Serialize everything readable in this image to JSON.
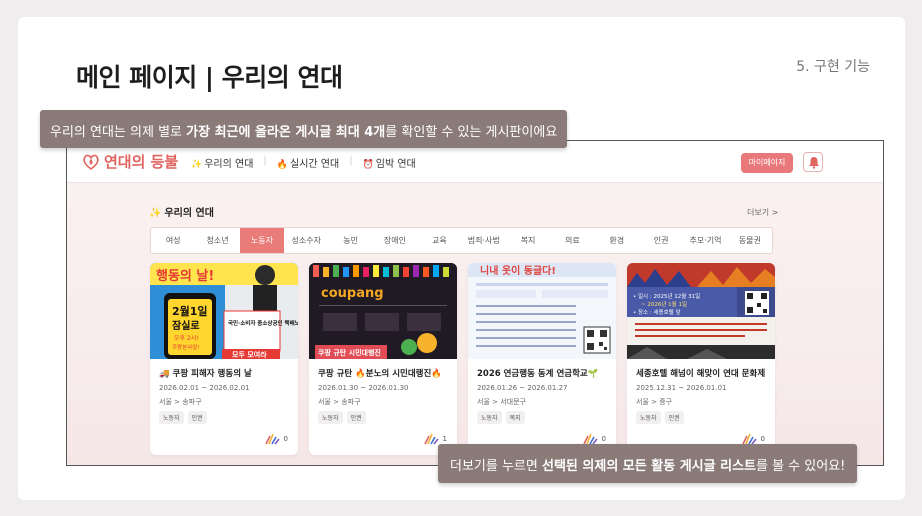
{
  "slide": {
    "title": "메인 페이지 | 우리의 연대",
    "section": "5. 구현 기능"
  },
  "callouts": {
    "top": {
      "pre": "우리의 연대는 의제 별로 ",
      "bold": "가장 최근에 올라온 게시글 최대 4개",
      "post": "를 확인할 수 있는 게시판이에요"
    },
    "bottom": {
      "pre": "더보기를 누르면 ",
      "bold": "선택된 의제의 모든 활동 게시글 리스트",
      "post": "를 볼 수 있어요!"
    }
  },
  "app": {
    "logo_text": "연대의 등불",
    "nav": [
      {
        "icon": "✨",
        "label": "우리의 연대"
      },
      {
        "icon": "🔥",
        "label": "실시간 연대"
      },
      {
        "icon": "⏰",
        "label": "임박 연대"
      }
    ],
    "mypage_label": "마이페이지",
    "board_title": "우리의 연대",
    "board_title_icon": "✨",
    "more_label": "더보기 >",
    "tabs": [
      "여성",
      "청소년",
      "노동자",
      "성소수자",
      "농민",
      "장애인",
      "교육",
      "범죄·사법",
      "복지",
      "의료",
      "환경",
      "인권",
      "추모·기억",
      "동물권"
    ],
    "active_tab": "노동자",
    "cards": [
      {
        "title": "🚚 쿠팡 피해자 행동의 날",
        "date": "2026.02.01 ~ 2026.02.01",
        "location": "서울 > 송파구",
        "tags": [
          "노동자",
          "인권"
        ],
        "count": "0",
        "thumb": {
          "headline": "행동의 날!",
          "date_big": "2월1일",
          "place": "잠실로",
          "time": "오후 2시!",
          "place2": "쿠팡본사앞!",
          "side": "국민·소비자 중소상공인 택배노동자",
          "cta": "모두 모여라"
        }
      },
      {
        "title": "쿠팡 규탄 🔥분노의 시민대행진🔥",
        "date": "2026.01.30 ~ 2026.01.30",
        "location": "서울 > 송파구",
        "tags": [
          "노동자",
          "인권"
        ],
        "count": "1",
        "thumb": {
          "brand": "coupang",
          "banner": "쿠팡 규탄 시민대행진"
        }
      },
      {
        "title": "2026 연금행동 동계 연금학교🌱",
        "date": "2026.01.26 ~ 2026.01.27",
        "location": "서울 > 서대문구",
        "tags": [
          "노동자",
          "복지"
        ],
        "count": "0",
        "thumb": {
          "headline": "니내 옷이 동글다!"
        }
      },
      {
        "title": "세종호텔 해넘이 해맞이 연대 문화제",
        "date": "2025.12.31 ~ 2026.01.01",
        "location": "서울 > 중구",
        "tags": [
          "노동자",
          "인권"
        ],
        "count": "0",
        "thumb": {
          "line1": "• 일시 : 2025년 12월 31일",
          "line2": "~ 2026년 1월 1일",
          "line3": "• 장소 : 세종호텔 앞"
        }
      }
    ]
  },
  "colors": {
    "accent": "#e97c79",
    "callout_bg": "#8a7b79"
  }
}
